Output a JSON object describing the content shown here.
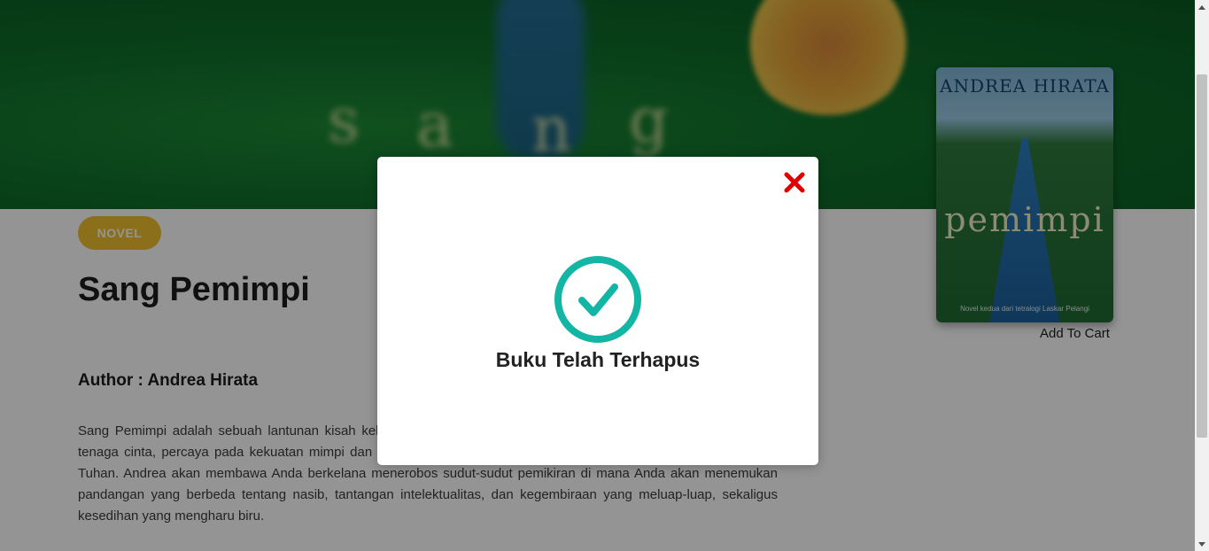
{
  "book": {
    "category": "NOVEL",
    "title": "Sang Pemimpi",
    "author_line": "Author : Andrea Hirata",
    "description": "Sang Pemimpi adalah sebuah lantunan kisah kehidupan yang memesona dan akan membuat Anda percaya akan tenaga cinta, percaya pada kekuatan mimpi dan pengorbanan, lebih dari itu, akan membuat Anda percaya kepada Tuhan. Andrea akan membawa Anda berkelana menerobos sudut-sudut pemikiran di mana Anda akan menemukan pandangan yang berbeda tentang nasib, tantangan intelektualitas, dan kegembiraan yang meluap-luap, sekaligus kesedihan yang mengharu biru.",
    "cover": {
      "author": "ANDREA HIRATA",
      "title": "pemimpi",
      "subtitle": "Novel kedua dari tetralogi Laskar Pelangi"
    },
    "add_to_cart_label": "Add To Cart"
  },
  "modal": {
    "message": "Buku Telah Terhapus",
    "close_icon": "close-icon",
    "status_icon": "check-circle-icon",
    "close_color": "#e00000",
    "check_color": "#13b5a4"
  },
  "colors": {
    "badge": "#f1bf2d",
    "overlay": "rgba(0,0,0,0.42)"
  }
}
